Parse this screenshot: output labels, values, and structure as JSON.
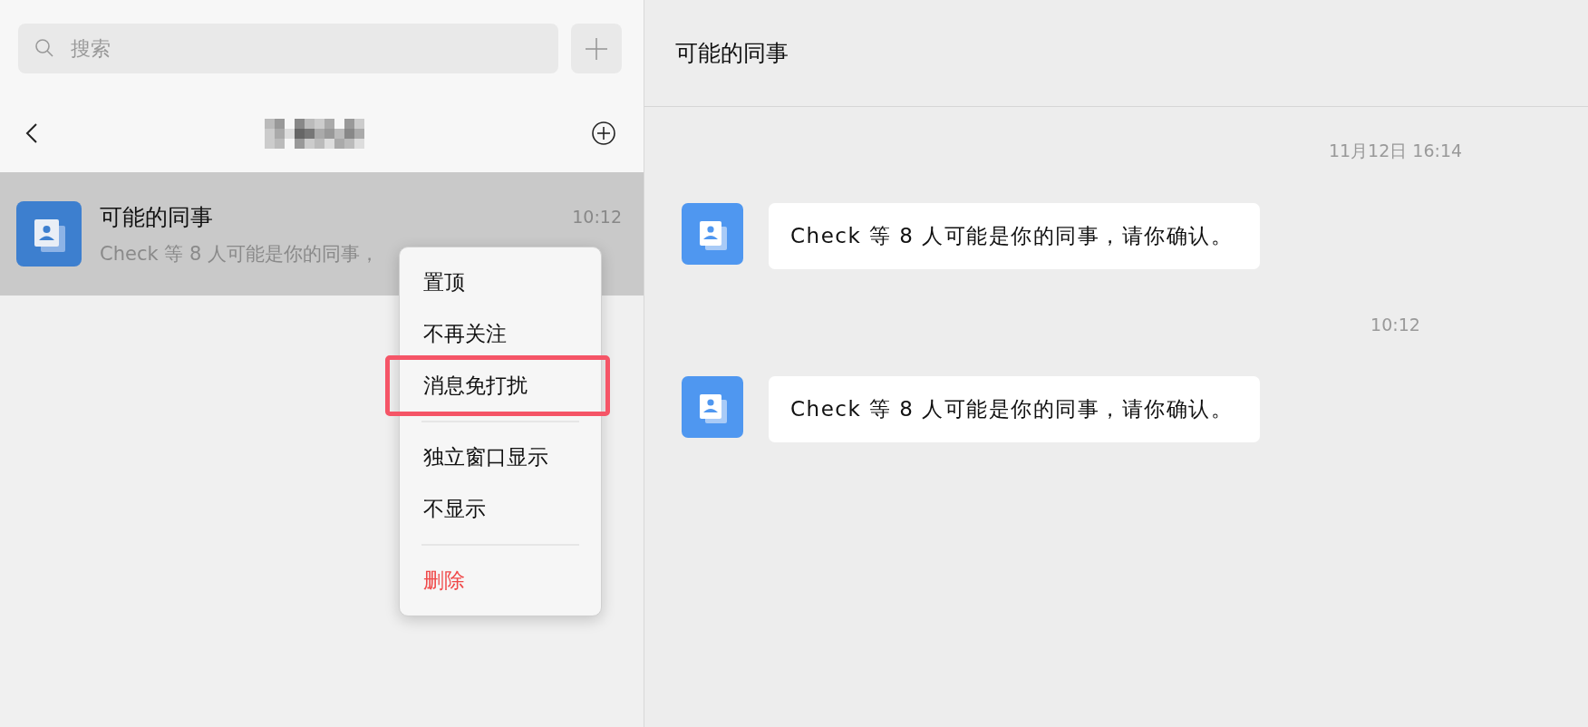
{
  "search": {
    "placeholder": "搜索"
  },
  "chats": [
    {
      "name": "可能的同事",
      "preview": "Check 等 8 人可能是你的同事，",
      "time": "10:12",
      "selected": true
    }
  ],
  "context_menu": {
    "groups": [
      [
        {
          "label": "置顶",
          "kind": "normal",
          "highlighted": false
        },
        {
          "label": "不再关注",
          "kind": "normal",
          "highlighted": false
        },
        {
          "label": "消息免打扰",
          "kind": "normal",
          "highlighted": true
        }
      ],
      [
        {
          "label": "独立窗口显示",
          "kind": "normal",
          "highlighted": false
        },
        {
          "label": "不显示",
          "kind": "normal",
          "highlighted": false
        }
      ],
      [
        {
          "label": "删除",
          "kind": "danger",
          "highlighted": false
        }
      ]
    ]
  },
  "conversation": {
    "title": "可能的同事",
    "messages": [
      {
        "timestamp": "11月12日 16:14",
        "text": "Check 等 8 人可能是你的同事，请你确认。"
      },
      {
        "timestamp": "10:12",
        "text": "Check 等 8 人可能是你的同事，请你确认。"
      }
    ]
  }
}
